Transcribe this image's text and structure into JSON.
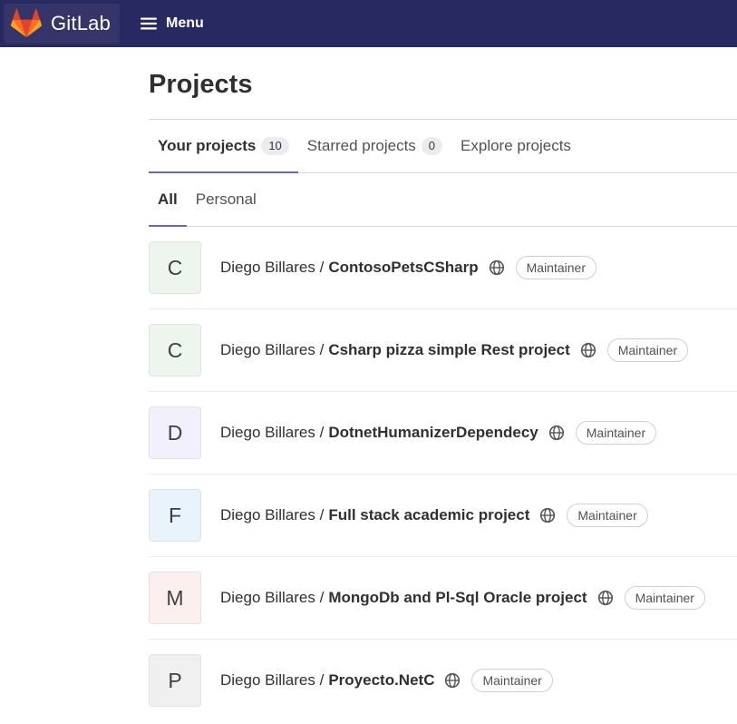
{
  "header": {
    "logo_text": "GitLab",
    "menu_label": "Menu",
    "background": "#292961"
  },
  "page": {
    "title": "Projects"
  },
  "tabs": [
    {
      "label": "Your projects",
      "count": "10",
      "active": true
    },
    {
      "label": "Starred projects",
      "count": "0",
      "active": false
    },
    {
      "label": "Explore projects",
      "active": false
    }
  ],
  "subtabs": [
    {
      "label": "All",
      "active": true
    },
    {
      "label": "Personal",
      "active": false
    }
  ],
  "projects": [
    {
      "letter": "C",
      "namespace": "Diego Billares /",
      "name": "ContosoPetsCSharp",
      "role": "Maintainer",
      "avatar_color": "#eef5ee",
      "visibility_icon": "globe-icon"
    },
    {
      "letter": "C",
      "namespace": "Diego Billares /",
      "name": "Csharp pizza simple Rest project",
      "role": "Maintainer",
      "avatar_color": "#eef5ee",
      "visibility_icon": "globe-icon"
    },
    {
      "letter": "D",
      "namespace": "Diego Billares /",
      "name": "DotnetHumanizerDependecy",
      "role": "Maintainer",
      "avatar_color": "#f3f0fd",
      "visibility_icon": "globe-icon"
    },
    {
      "letter": "F",
      "namespace": "Diego Billares /",
      "name": "Full stack academic project",
      "role": "Maintainer",
      "avatar_color": "#e9f3fc",
      "visibility_icon": "globe-icon"
    },
    {
      "letter": "M",
      "namespace": "Diego Billares /",
      "name": "MongoDb and Pl-Sql Oracle project",
      "role": "Maintainer",
      "avatar_color": "#fcf0ee",
      "visibility_icon": "globe-icon"
    },
    {
      "letter": "P",
      "namespace": "Diego Billares /",
      "name": "Proyecto.NetC",
      "role": "Maintainer",
      "avatar_color": "#f0f0f0",
      "visibility_icon": "globe-icon"
    }
  ]
}
